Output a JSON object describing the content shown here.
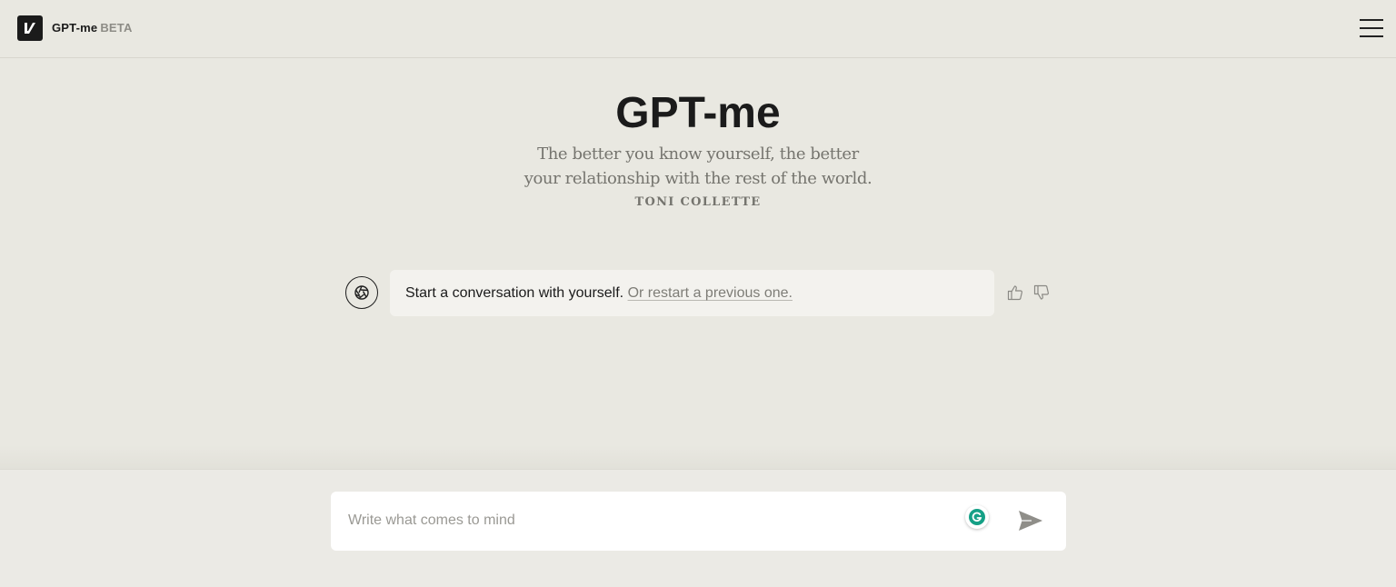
{
  "header": {
    "brand_name": "GPT-me",
    "brand_badge": "BETA",
    "logo_icon": "v-logo-icon",
    "menu_icon": "hamburger-menu-icon"
  },
  "hero": {
    "title": "GPT-me",
    "quote_line1": "The better you know yourself, the better",
    "quote_line2": "your relationship with the rest of the world.",
    "quote_author": "TONI COLLETTE"
  },
  "conversation": {
    "avatar_icon": "aperture-icon",
    "message_text": "Start a conversation with yourself.",
    "message_link": "Or restart a previous one.",
    "feedback_icons": [
      "thumbs-up-icon",
      "thumbs-down-icon"
    ]
  },
  "composer": {
    "placeholder": "Write what comes to mind",
    "value": "",
    "grammarly_icon": "grammarly-icon",
    "send_icon": "send-icon"
  },
  "colors": {
    "background": "#e9e8e1",
    "bubble": "#f3f2ee",
    "text_dark": "#1b1b1b",
    "text_muted": "#75746e",
    "grammarly_green": "#15a086"
  }
}
